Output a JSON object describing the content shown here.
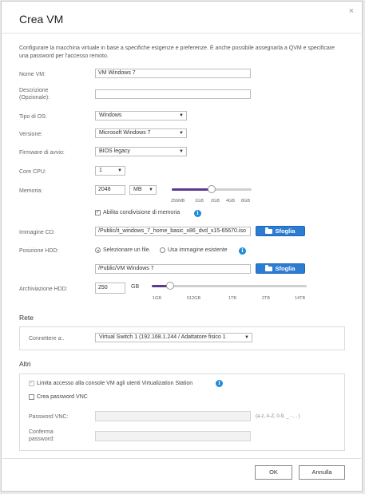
{
  "dialog": {
    "title": "Crea VM",
    "close_icon": "×",
    "description": "Configurare la macchina virtuale in base a specifiche esigenze e preferenze. È anche possibile assegnarla a QVM e specificare una password per l'accesso remoto."
  },
  "form": {
    "name_label": "Nome VM:",
    "name_value": "VM Windows 7",
    "desc_label": "Descrizione (Opzionale):",
    "desc_value": "",
    "os_type_label": "Tipo di OS:",
    "os_type_value": "Windows",
    "version_label": "Versione:",
    "version_value": "Microsoft Windows 7",
    "firmware_label": "Firmware di avvio:",
    "firmware_value": "BIOS legacy",
    "cpu_label": "Core CPU:",
    "cpu_value": "1",
    "memory_label": "Memoria:",
    "memory_value": "2048",
    "memory_unit": "MB",
    "memory_ticks": [
      "256MB",
      "1GB",
      "2GB",
      "4GB",
      "8GB"
    ],
    "memory_slider_level": 0.5,
    "memory_share_label": "Abilita condivisione di memoria",
    "memory_share_checked": true,
    "cd_label": "Immagine CD:",
    "cd_value": "/Public/it_windows_7_home_basic_x86_dvd_x15-65670.iso",
    "browse_label": "Sfoglia",
    "hdd_pos_label": "Posizione HDD:",
    "hdd_radio_select": "Selezionare un file.",
    "hdd_radio_existing": "Usa immagine esistente",
    "hdd_path_value": "/Public/VM Windows 7",
    "hdd_browse_label": "Sfoglia",
    "hdd_storage_label": "Archiviazione HDD:",
    "hdd_storage_value": "250",
    "hdd_storage_unit": "GB",
    "hdd_ticks": [
      "1GB",
      "512GB",
      "1TB",
      "2TB",
      "14TB"
    ],
    "hdd_slider_level": 0.12
  },
  "network": {
    "section_title": "Rete",
    "connect_label": "Connettere a:.",
    "connect_value": "Virtual Switch 1 (192.168.1.244 / Adattatore fisico 1"
  },
  "other": {
    "section_title": "Altri",
    "limit_access_label": "Limita accesso alla console VM agli utenti Virtualization Station",
    "create_pw_label": "Crea password VNC",
    "vnc_pw_label": "Password VNC:",
    "vnc_pw_hint": "(a-z, A-Z, 0-9, _ - , . )",
    "confirm_pw_label": "Conferma password:"
  },
  "footer": {
    "ok_label": "OK",
    "cancel_label": "Annulla"
  },
  "colors": {
    "accent": "#2b7cd3",
    "slider_fill": "#5b3b8c",
    "info": "#1e8bd6"
  }
}
